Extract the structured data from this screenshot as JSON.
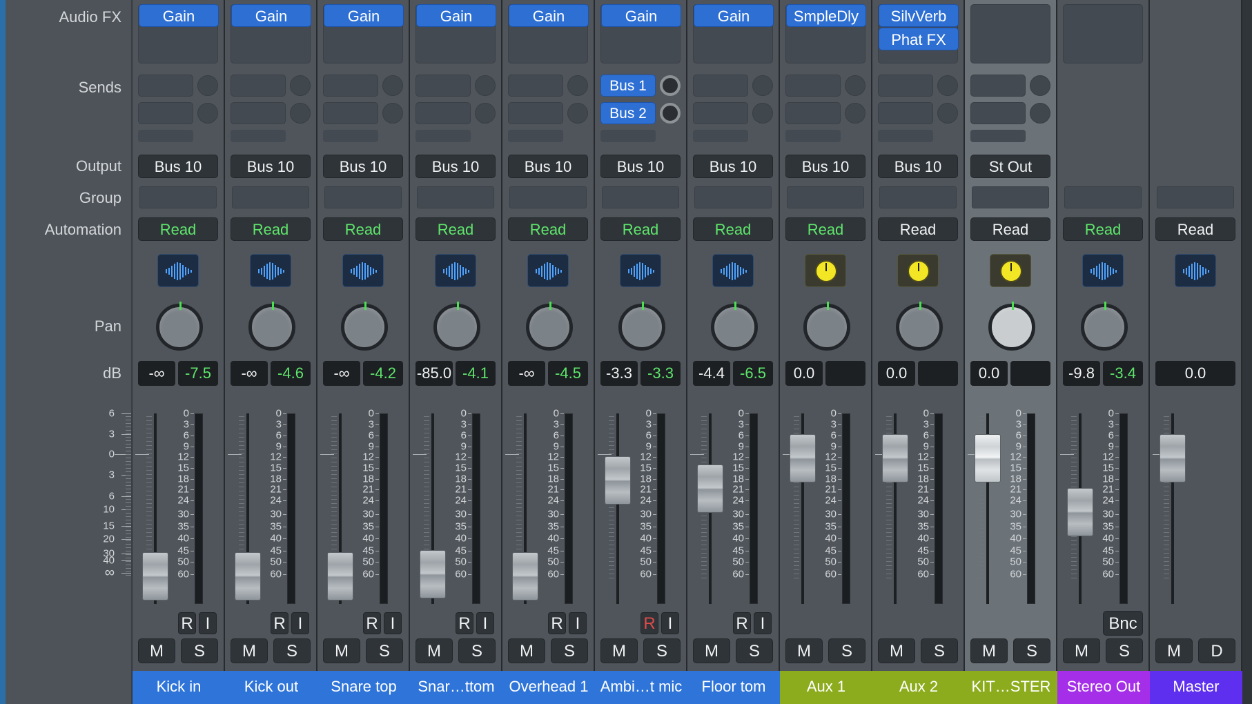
{
  "labels": {
    "audio_fx": "Audio FX",
    "sends": "Sends",
    "output": "Output",
    "group": "Group",
    "automation": "Automation",
    "pan": "Pan",
    "db": "dB"
  },
  "inf_scale": [
    "6",
    "3",
    "0",
    "3",
    "6",
    "10",
    "15",
    "20",
    "30",
    "40",
    "∞"
  ],
  "meter_scale": [
    "0",
    "3",
    "6",
    "9",
    "12",
    "15",
    "18",
    "21",
    "24",
    "30",
    "35",
    "40",
    "45",
    "50",
    "60"
  ],
  "colors": {
    "track_blue": "#2f75d9",
    "aux_green": "#8cac1e",
    "stereo_out_purple": "#a52ee8",
    "master_violet": "#5f2ff0",
    "read_green": "#5ee66b",
    "peak_green": "#5ee66b",
    "plugin_blue": "#2e6fd3",
    "rec_red": "#e04b4b"
  },
  "strips": [
    {
      "name": "Kick in",
      "type": "track",
      "fx": [
        "Gain"
      ],
      "sends": [],
      "output": "Bus 10",
      "automation": "Read",
      "icon": "waveform-icon",
      "volume": "-∞",
      "peak": "-7.5",
      "fader_db": "-∞",
      "ri": [
        "R",
        "I"
      ],
      "rec_armed": false,
      "ms": [
        "M",
        "S"
      ]
    },
    {
      "name": "Kick out",
      "type": "track",
      "fx": [
        "Gain"
      ],
      "sends": [],
      "output": "Bus 10",
      "automation": "Read",
      "icon": "waveform-icon",
      "volume": "-∞",
      "peak": "-4.6",
      "fader_db": "-∞",
      "ri": [
        "R",
        "I"
      ],
      "rec_armed": false,
      "ms": [
        "M",
        "S"
      ]
    },
    {
      "name": "Snare top",
      "type": "track",
      "fx": [
        "Gain"
      ],
      "sends": [],
      "output": "Bus 10",
      "automation": "Read",
      "icon": "waveform-icon",
      "volume": "-∞",
      "peak": "-4.2",
      "fader_db": "-∞",
      "ri": [
        "R",
        "I"
      ],
      "rec_armed": false,
      "ms": [
        "M",
        "S"
      ]
    },
    {
      "name": "Snar…ttom",
      "type": "track",
      "fx": [
        "Gain"
      ],
      "sends": [],
      "output": "Bus 10",
      "automation": "Read",
      "icon": "waveform-icon",
      "volume": "-85.0",
      "peak": "-4.1",
      "fader_db": "-85.0",
      "ri": [
        "R",
        "I"
      ],
      "rec_armed": false,
      "ms": [
        "M",
        "S"
      ]
    },
    {
      "name": "Overhead 1",
      "type": "track",
      "fx": [
        "Gain"
      ],
      "sends": [],
      "output": "Bus 10",
      "automation": "Read",
      "icon": "waveform-icon",
      "volume": "-∞",
      "peak": "-4.5",
      "fader_db": "-∞",
      "ri": [
        "R",
        "I"
      ],
      "rec_armed": false,
      "ms": [
        "M",
        "S"
      ]
    },
    {
      "name": "Ambi…t mic",
      "type": "track",
      "fx": [
        "Gain"
      ],
      "sends": [
        "Bus 1",
        "Bus 2"
      ],
      "output": "Bus 10",
      "automation": "Read",
      "icon": "waveform-icon",
      "volume": "-3.3",
      "peak": "-3.3",
      "fader_db": "-3.3",
      "ri": [
        "R",
        "I"
      ],
      "rec_armed": true,
      "ms": [
        "M",
        "S"
      ]
    },
    {
      "name": "Floor tom",
      "type": "track",
      "fx": [
        "Gain"
      ],
      "sends": [],
      "output": "Bus 10",
      "automation": "Read",
      "icon": "waveform-icon",
      "volume": "-4.4",
      "peak": "-6.5",
      "fader_db": "-4.4",
      "ri": [
        "R",
        "I"
      ],
      "rec_armed": false,
      "ms": [
        "M",
        "S"
      ]
    },
    {
      "name": "Aux 1",
      "type": "aux",
      "fx": [
        "SmpleDly"
      ],
      "sends": [],
      "output": "Bus 10",
      "automation": "Read",
      "icon": "yellow-knob-icon",
      "volume": "0.0",
      "peak": "",
      "fader_db": "0.0",
      "ri": [],
      "rec_armed": false,
      "ms": [
        "M",
        "S"
      ]
    },
    {
      "name": "Aux 2",
      "type": "aux",
      "fx": [
        "SilvVerb",
        "Phat FX"
      ],
      "sends": [],
      "output": "Bus 10",
      "automation": "Read",
      "icon": "yellow-knob-icon",
      "volume": "0.0",
      "peak": "",
      "fader_db": "0.0",
      "ri": [],
      "rec_armed": false,
      "ms": [
        "M",
        "S"
      ]
    },
    {
      "name": "KIT…STER",
      "type": "aux-selected",
      "fx": [],
      "sends": [],
      "output": "St Out",
      "automation": "Read",
      "icon": "yellow-knob-icon",
      "volume": "0.0",
      "peak": "",
      "fader_db": "0.0",
      "ri": [],
      "rec_armed": false,
      "ms": [
        "M",
        "S"
      ]
    },
    {
      "name": "Stereo Out",
      "type": "stereo",
      "fx": [],
      "sends": null,
      "output": "",
      "automation": "Read",
      "icon": "waveform-icon",
      "volume": "-9.8",
      "peak": "-3.4",
      "fader_db": "-9.8",
      "ri": [],
      "bnc": "Bnc",
      "rec_armed": false,
      "ms": [
        "M",
        "S"
      ]
    },
    {
      "name": "Master",
      "type": "master",
      "fx": null,
      "sends": null,
      "output": "",
      "automation": "Read",
      "icon": "waveform-icon",
      "volume": "0.0",
      "peak": null,
      "fader_db": "0.0",
      "ri": [],
      "rec_armed": false,
      "ms": [
        "M",
        "D"
      ]
    }
  ]
}
